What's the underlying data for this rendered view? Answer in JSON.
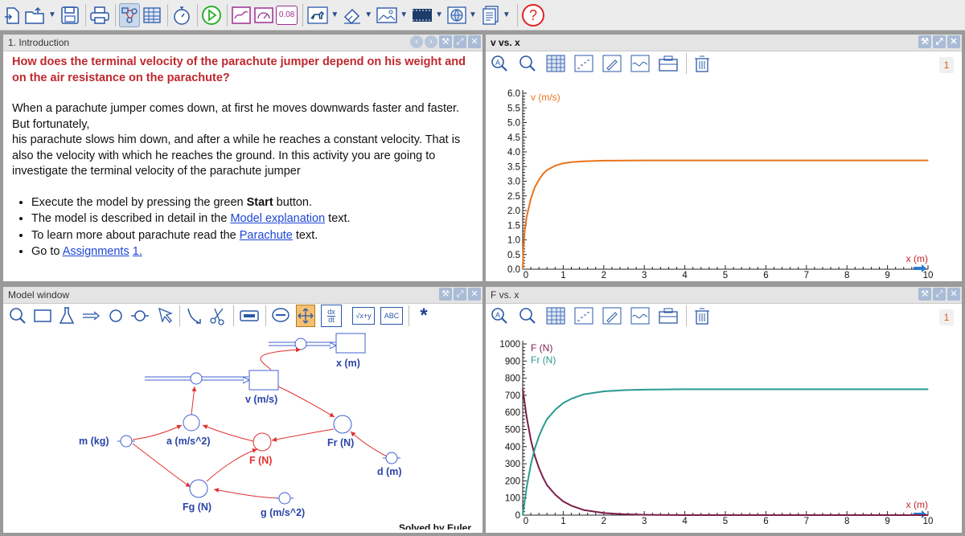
{
  "toolbar": {
    "items": [
      "new-file",
      "open-file",
      "save",
      "print",
      "model-view",
      "table-view",
      "timer",
      "start",
      "graph",
      "meter",
      "value-display",
      "animation",
      "sketch",
      "image",
      "video",
      "web",
      "document",
      "help"
    ],
    "value_display": "0.08"
  },
  "intro": {
    "title": "1. Introduction",
    "question": "How does the terminal velocity of the parachute jumper depend on his weight and on the air resistance on the parachute?",
    "p1": "When a parachute jumper comes down, at first he moves downwards faster and faster. But fortunately,",
    "p2": "his parachute slows him down, and after a while he reaches a constant velocity. That is also the velocity with which he reaches the ground. In this activity you are going to investigate the terminal velocity of the parachute jumper",
    "b1_pre": "Execute the model by pressing the green ",
    "b1_bold": "Start",
    "b1_post": " button.",
    "b2_pre": "The model is described in detail in the ",
    "b2_link": "Model explanation",
    "b2_post": " text.",
    "b3_pre": "To learn more about parachute read the ",
    "b3_link": "Parachute",
    "b3_post": " text.",
    "b4_pre": "Go to ",
    "b4_link1": "Assignments",
    "b4_link2": "1."
  },
  "graph1": {
    "title": "v vs. x",
    "badge": "1"
  },
  "graph2": {
    "title": "F vs. x",
    "badge": "1"
  },
  "model": {
    "title": "Model window",
    "dxdt_top": "dx",
    "dxdt_bottom": "dt",
    "formula_label": "√x+y",
    "text_label": "ABC",
    "footer": "Solved by Euler",
    "nodes": {
      "x": "x (m)",
      "v": "v (m/s)",
      "a": "a (m/s^2)",
      "m": "m (kg)",
      "F": "F (N)",
      "Fr": "Fr (N)",
      "d": "d (m)",
      "Fg": "Fg (N)",
      "g": "g (m/s^2)"
    }
  },
  "chart_data": [
    {
      "type": "line",
      "title": "",
      "xlabel": "x (m)",
      "ylabel": "v (m/s)",
      "xlim": [
        0,
        10
      ],
      "ylim": [
        0,
        6
      ],
      "x_ticks": [
        0,
        1,
        2,
        3,
        4,
        5,
        6,
        7,
        8,
        9,
        10
      ],
      "y_ticks": [
        "0.0",
        "0.5",
        "1.0",
        "1.5",
        "2.0",
        "2.5",
        "3.0",
        "3.5",
        "4.0",
        "4.5",
        "5.0",
        "5.5",
        "6.0"
      ],
      "series": [
        {
          "name": "v (m/s)",
          "color": "#e8731c",
          "x": [
            0,
            0.02,
            0.05,
            0.1,
            0.2,
            0.3,
            0.4,
            0.5,
            0.6,
            0.8,
            1.0,
            1.2,
            1.5,
            2.0,
            3.0,
            4.0,
            6.0,
            8.0,
            10.0
          ],
          "y": [
            0,
            0.8,
            1.3,
            1.8,
            2.4,
            2.8,
            3.05,
            3.25,
            3.38,
            3.53,
            3.61,
            3.65,
            3.68,
            3.7,
            3.71,
            3.71,
            3.71,
            3.71,
            3.71
          ]
        }
      ]
    },
    {
      "type": "line",
      "title": "",
      "xlabel": "x (m)",
      "ylabel": "",
      "xlim": [
        0,
        10
      ],
      "ylim": [
        0,
        1000
      ],
      "x_ticks": [
        0,
        1,
        2,
        3,
        4,
        5,
        6,
        7,
        8,
        9,
        10
      ],
      "y_ticks": [
        "0",
        "100",
        "200",
        "300",
        "400",
        "500",
        "600",
        "700",
        "800",
        "900",
        "1000"
      ],
      "series": [
        {
          "name": "F (N)",
          "color": "#7a1e4a",
          "x": [
            0,
            0.1,
            0.2,
            0.3,
            0.4,
            0.5,
            0.6,
            0.8,
            1.0,
            1.2,
            1.5,
            2.0,
            2.5,
            3.0,
            4.0,
            6.0,
            8.0,
            10.0
          ],
          "y": [
            735,
            570,
            440,
            345,
            275,
            220,
            175,
            120,
            80,
            55,
            30,
            12,
            5,
            2,
            0,
            0,
            0,
            0
          ]
        },
        {
          "name": "Fr (N)",
          "color": "#2a9a8f",
          "x": [
            0,
            0.1,
            0.2,
            0.3,
            0.4,
            0.5,
            0.6,
            0.8,
            1.0,
            1.2,
            1.5,
            2.0,
            2.5,
            3.0,
            4.0,
            6.0,
            8.0,
            10.0
          ],
          "y": [
            0,
            165,
            295,
            390,
            460,
            515,
            560,
            615,
            655,
            680,
            705,
            723,
            730,
            733,
            735,
            735,
            735,
            735
          ]
        }
      ]
    }
  ]
}
